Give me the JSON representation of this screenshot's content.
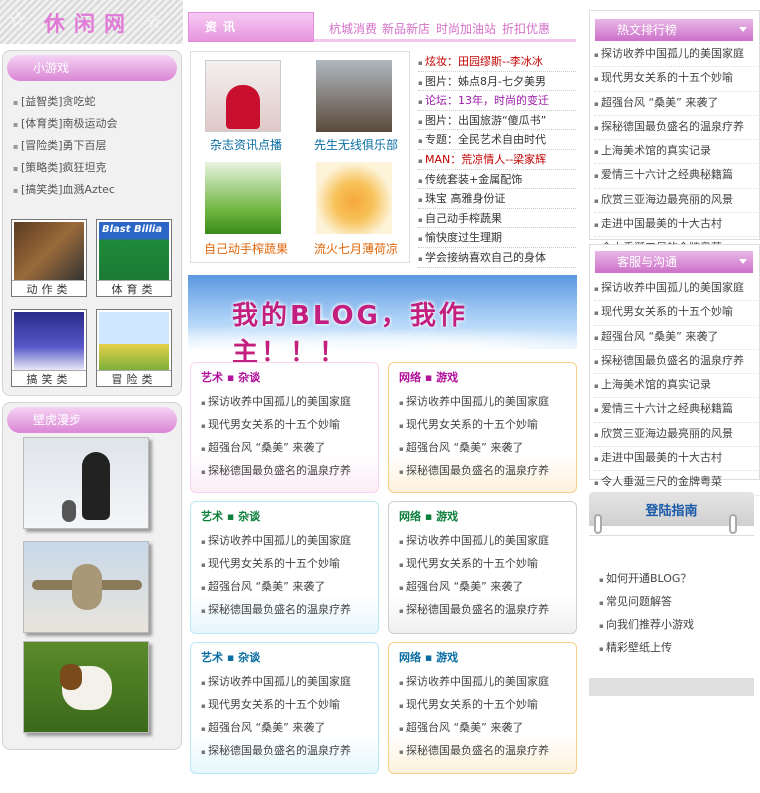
{
  "site": {
    "logo": "休闲网"
  },
  "games": {
    "title": "小游戏",
    "items": [
      "[益智类]贪吃蛇",
      "[体育类]南极运动会",
      "[冒险类]勇下百层",
      "[策略类]疯狂坦克",
      "[搞笑类]血溅Aztec"
    ],
    "tiles": [
      {
        "label": "动作类",
        "img": "Action game screenshot"
      },
      {
        "label": "体育类",
        "img": "Blast Billiards"
      },
      {
        "label": "搞笑类",
        "img": "Funny game screenshot"
      },
      {
        "label": "冒险类",
        "img": "Adventure game screenshot"
      }
    ]
  },
  "wallpaper": {
    "title": "壁虎漫步",
    "photos": [
      "penguins",
      "airplane",
      "puppy"
    ]
  },
  "nav": {
    "tab": "资讯",
    "links": [
      "杭城消费",
      "新品新店",
      "时尚加油站",
      "折扣优惠"
    ]
  },
  "news": {
    "captions": [
      "杂志资讯点播",
      "先生无线俱乐部",
      "自己动手榨蔬果",
      "流火七月薄荷凉"
    ],
    "list": [
      {
        "text": "炫妆：田园缪斯--李冰冰",
        "color": "#c40000"
      },
      {
        "text": "图片：姊点8月-七夕美男",
        "color": "#333"
      },
      {
        "text": "论坛：13年，时尚的变迁",
        "color": "#9b1aa8"
      },
      {
        "text": "图片：出国旅游“傻瓜书”",
        "color": "#333"
      },
      {
        "text": "专题：全民艺术自由时代",
        "color": "#333"
      },
      {
        "text": "MAN：荒凉情人--梁家辉",
        "color": "#c40000"
      },
      {
        "text": "传统套装+金属配饰",
        "color": "#333"
      },
      {
        "text": "珠宝 高雅身份证",
        "color": "#333"
      },
      {
        "text": "自己动手榨蔬果",
        "color": "#333"
      },
      {
        "text": "愉快度过生理期",
        "color": "#333"
      },
      {
        "text": "学会接纳喜欢自己的身体",
        "color": "#333"
      }
    ]
  },
  "banner": {
    "text": "我的BLOG，我作主！！！"
  },
  "cards": [
    {
      "title": "艺术 ▪ 杂谈",
      "color": "#b0109a",
      "items": [
        "探访收养中国孤儿的美国家庭",
        "现代男女关系的十五个妙喻",
        "超强台风 “桑美” 来袭了",
        "探秘德国最负盛名的温泉疗养"
      ]
    },
    {
      "title": "网络 ▪ 游戏",
      "color": "#b0109a",
      "items": [
        "探访收养中国孤儿的美国家庭",
        "现代男女关系的十五个妙喻",
        "超强台风 “桑美” 来袭了",
        "探秘德国最负盛名的温泉疗养"
      ]
    },
    {
      "title": "艺术 ▪ 杂谈",
      "color": "#0d7f3a",
      "items": [
        "探访收养中国孤儿的美国家庭",
        "现代男女关系的十五个妙喻",
        "超强台风 “桑美” 来袭了",
        "探秘德国最负盛名的温泉疗养"
      ]
    },
    {
      "title": "网络 ▪ 游戏",
      "color": "#0d7f3a",
      "items": [
        "探访收养中国孤儿的美国家庭",
        "现代男女关系的十五个妙喻",
        "超强台风 “桑美” 来袭了",
        "探秘德国最负盛名的温泉疗养"
      ]
    },
    {
      "title": "艺术 ▪ 杂谈",
      "color": "#0a6ea3",
      "items": [
        "探访收养中国孤儿的美国家庭",
        "现代男女关系的十五个妙喻",
        "超强台风 “桑美” 来袭了",
        "探秘德国最负盛名的温泉疗养"
      ]
    },
    {
      "title": "网络 ▪ 游戏",
      "color": "#0a6ea3",
      "items": [
        "探访收养中国孤儿的美国家庭",
        "现代男女关系的十五个妙喻",
        "超强台风 “桑美” 来袭了",
        "探秘德国最负盛名的温泉疗养"
      ]
    }
  ],
  "hot": {
    "title": "热文排行榜",
    "items": [
      "探访收养中国孤儿的美国家庭",
      "现代男女关系的十五个妙喻",
      "超强台风 “桑美” 来袭了",
      "探秘德国最负盛名的温泉疗养",
      "上海美术馆的真实记录",
      "爱情三十六计之经典秘籍篇",
      "欣赏三亚海边最亮丽的风景",
      "走进中国最美的十大古村",
      "令人垂涎三尺的金牌粤菜"
    ]
  },
  "service": {
    "title": "客服与沟通",
    "items": [
      "探访收养中国孤儿的美国家庭",
      "现代男女关系的十五个妙喻",
      "超强台风 “桑美” 来袭了",
      "探秘德国最负盛名的温泉疗养",
      "上海美术馆的真实记录",
      "爱情三十六计之经典秘籍篇",
      "欣赏三亚海边最亮丽的风景",
      "走进中国最美的十大古村",
      "令人垂涎三尺的金牌粤菜"
    ]
  },
  "login": {
    "title": "登陆指南",
    "items": [
      "如何开通BLOG？",
      "常见问题解答",
      "向我们推荐小游戏",
      "精彩壁纸上传"
    ]
  }
}
